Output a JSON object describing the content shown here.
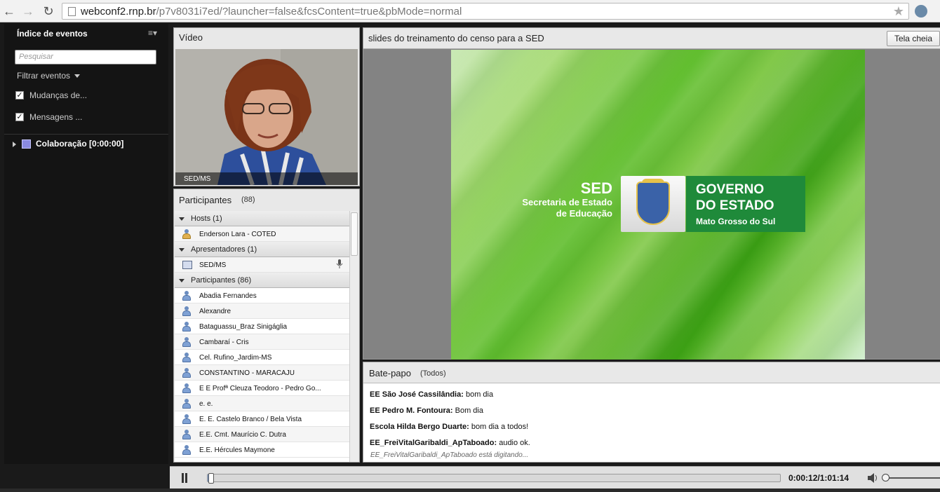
{
  "browser": {
    "url_host": "webconf2.rnp.br",
    "url_path": "/p7v8031i7ed/?launcher=false&fcsContent=true&pbMode=normal"
  },
  "sidebar": {
    "title": "Índice de eventos",
    "search_placeholder": "Pesquisar",
    "filter_label": "Filtrar eventos",
    "checks": [
      {
        "label": "Mudanças de...",
        "checked": true
      },
      {
        "label": "Mensagens ...",
        "checked": true
      }
    ],
    "tree_item": "Colaboração [0:00:00]"
  },
  "video": {
    "title": "Vídeo",
    "feed_label": "SED/MS"
  },
  "participants": {
    "title": "Participantes",
    "count": "(88)",
    "groups": {
      "hosts": {
        "label": "Hosts (1)",
        "members": [
          "Enderson Lara - COTED"
        ]
      },
      "presenters": {
        "label": "Apresentadores (1)",
        "members": [
          "SED/MS"
        ]
      },
      "participants": {
        "label": "Participantes (86)",
        "members": [
          "Abadia Fernandes",
          "Alexandre",
          "Bataguassu_Braz Sinigáglia",
          "Cambaraí - Cris",
          "Cel. Rufino_Jardim-MS",
          "CONSTANTINO - MARACAJU",
          "E E Profª Cleuza Teodoro - Pedro Go...",
          "e. e.",
          "E. E. Castelo Branco / Bela Vista",
          "E.E. Cmt. Maurício C. Dutra",
          "E.E. Hércules Maymone"
        ]
      }
    }
  },
  "share": {
    "title": "slides do treinamento do censo para a SED",
    "fullscreen_label": "Tela cheia",
    "slide": {
      "sed": "SED",
      "sed_line1": "Secretaria de Estado",
      "sed_line2": "de Educação",
      "gov_line1": "GOVERNO",
      "gov_line2": "DO ESTADO",
      "gov_line3": "Mato Grosso do Sul"
    }
  },
  "chat": {
    "title": "Bate-papo",
    "scope": "(Todos)",
    "messages": [
      {
        "author": "EE São José Cassilândia:",
        "text": "bom dia"
      },
      {
        "author": "EE Pedro M. Fontoura:",
        "text": "Bom dia"
      },
      {
        "author": "Escola Hilda Bergo Duarte:",
        "text": "bom dia a todos!"
      },
      {
        "author": "EE_FreiVitalGaribaldi_ApTaboado:",
        "text": "audio ok."
      }
    ],
    "typing": "EE_FreiVitalGaribaldi_ApTaboado está digitando..."
  },
  "playback": {
    "time": "0:00:12/1:01:14",
    "progress_fraction": 0.003,
    "volume_fraction": 0.0
  },
  "colors": {
    "accent": "#7a9ccf",
    "gov_green": "#1f8a3a"
  }
}
